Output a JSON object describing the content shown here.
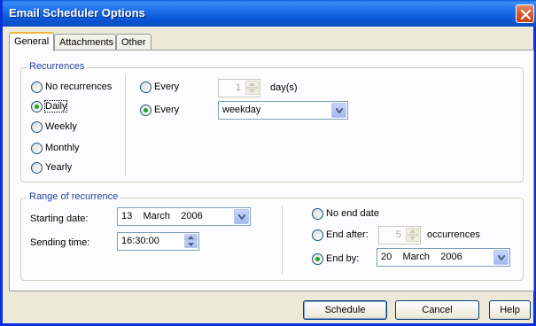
{
  "window": {
    "title": "Email Scheduler Options",
    "close_icon": "close-icon"
  },
  "tabs": [
    {
      "label": "General",
      "active": true
    },
    {
      "label": "Attachments",
      "active": false
    },
    {
      "label": "Other",
      "active": false
    }
  ],
  "recurrences": {
    "legend": "Recurrences",
    "options": [
      {
        "label": "No recurrences",
        "checked": false
      },
      {
        "label": "Daily",
        "checked": true
      },
      {
        "label": "Weekly",
        "checked": false
      },
      {
        "label": "Monthly",
        "checked": false
      },
      {
        "label": "Yearly",
        "checked": false
      }
    ],
    "every_days": {
      "label": "Every",
      "value": "1",
      "unit": "day(s)",
      "checked": false
    },
    "every_weekday": {
      "label": "Every",
      "value": "weekday",
      "checked": true
    }
  },
  "range": {
    "legend": "Range of recurrence",
    "starting_date_label": "Starting date:",
    "starting_date_value": "13    March    2006",
    "sending_time_label": "Sending time:",
    "sending_time_value": "16:30:00",
    "no_end_date": {
      "label": "No end date",
      "checked": false
    },
    "end_after": {
      "label": "End after:",
      "value": "5",
      "unit": "occurrences",
      "checked": false
    },
    "end_by": {
      "label": "End by:",
      "value": "20    March    2006",
      "checked": true
    }
  },
  "buttons": {
    "schedule": "Schedule",
    "cancel": "Cancel",
    "help": "Help"
  },
  "colors": {
    "titlebar": "#0a58d6",
    "accent_legend": "#1f3f9f",
    "radio_dot": "#21a121"
  }
}
